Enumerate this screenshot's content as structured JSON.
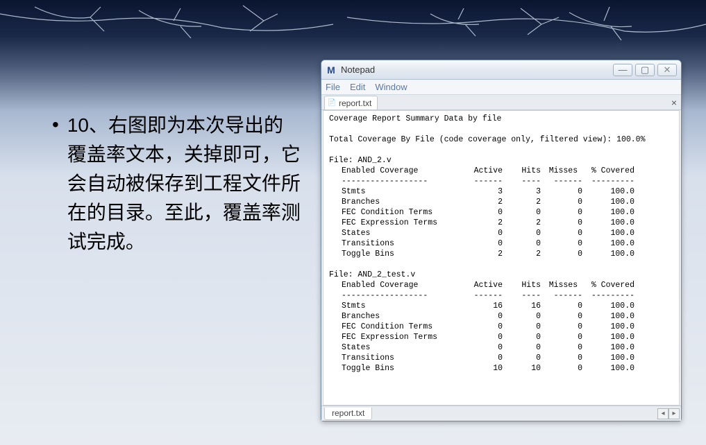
{
  "slide": {
    "bullet": "•",
    "text": "10、右图即为本次导出的覆盖率文本，关掉即可，它会自动被保存到工程文件所在的目录。至此，覆盖率测试完成。"
  },
  "window": {
    "app_icon": "M",
    "title": "Notepad",
    "menu": {
      "file": "File",
      "edit": "Edit",
      "window": "Window"
    },
    "tab_name": "report.txt",
    "tab_close": "×",
    "bottom_tab": "report.txt",
    "controls": {
      "min": "—",
      "max": "▢",
      "close": "✕"
    },
    "scroll": {
      "left": "◂",
      "right": "▸"
    }
  },
  "chart_data": {
    "type": "table",
    "title": "Coverage Report Summary Data by file",
    "summary_line": "Total Coverage By File (code coverage only, filtered view): 100.0%",
    "columns": [
      "Enabled Coverage",
      "Active",
      "Hits",
      "Misses",
      "% Covered"
    ],
    "files": [
      {
        "name": "File: AND_2.v",
        "rows": [
          {
            "label": "Stmts",
            "active": 3,
            "hits": 3,
            "misses": 0,
            "covered": "100.0"
          },
          {
            "label": "Branches",
            "active": 2,
            "hits": 2,
            "misses": 0,
            "covered": "100.0"
          },
          {
            "label": "FEC Condition Terms",
            "active": 0,
            "hits": 0,
            "misses": 0,
            "covered": "100.0"
          },
          {
            "label": "FEC Expression Terms",
            "active": 2,
            "hits": 2,
            "misses": 0,
            "covered": "100.0"
          },
          {
            "label": "States",
            "active": 0,
            "hits": 0,
            "misses": 0,
            "covered": "100.0"
          },
          {
            "label": "Transitions",
            "active": 0,
            "hits": 0,
            "misses": 0,
            "covered": "100.0"
          },
          {
            "label": "Toggle Bins",
            "active": 2,
            "hits": 2,
            "misses": 0,
            "covered": "100.0"
          }
        ]
      },
      {
        "name": "File: AND_2_test.v",
        "rows": [
          {
            "label": "Stmts",
            "active": 16,
            "hits": 16,
            "misses": 0,
            "covered": "100.0"
          },
          {
            "label": "Branches",
            "active": 0,
            "hits": 0,
            "misses": 0,
            "covered": "100.0"
          },
          {
            "label": "FEC Condition Terms",
            "active": 0,
            "hits": 0,
            "misses": 0,
            "covered": "100.0"
          },
          {
            "label": "FEC Expression Terms",
            "active": 0,
            "hits": 0,
            "misses": 0,
            "covered": "100.0"
          },
          {
            "label": "States",
            "active": 0,
            "hits": 0,
            "misses": 0,
            "covered": "100.0"
          },
          {
            "label": "Transitions",
            "active": 0,
            "hits": 0,
            "misses": 0,
            "covered": "100.0"
          },
          {
            "label": "Toggle Bins",
            "active": 10,
            "hits": 10,
            "misses": 0,
            "covered": "100.0"
          }
        ]
      }
    ],
    "header_sep": {
      "label": "------------------",
      "col": "------",
      "hits": "----",
      "misses": "------",
      "covered": "---------"
    }
  }
}
